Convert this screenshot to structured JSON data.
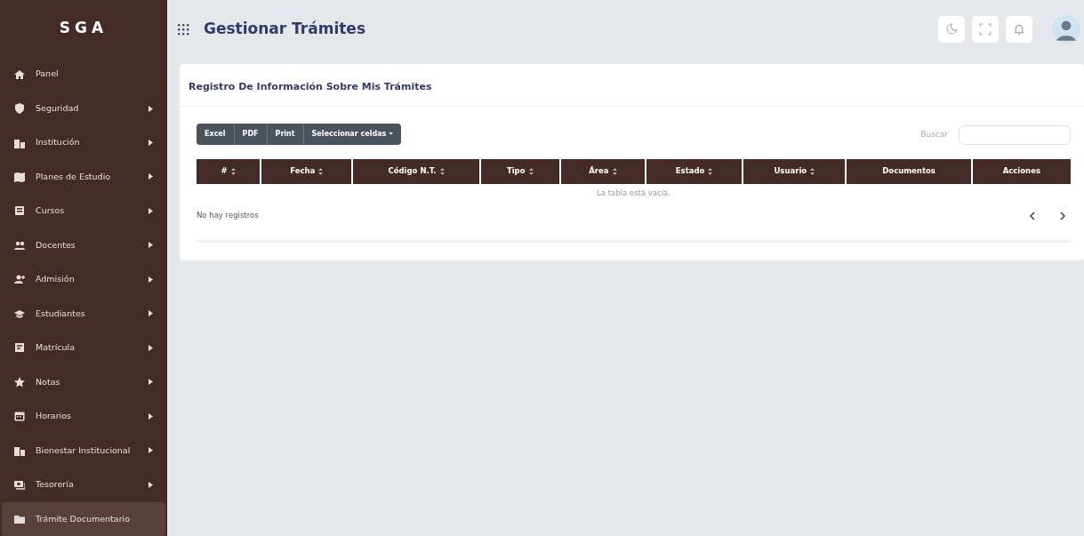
{
  "sidebar": {
    "brand": "SGA",
    "items": [
      {
        "label": "Panel",
        "expandable": false,
        "selected": false
      },
      {
        "label": "Seguridad",
        "expandable": true,
        "selected": false
      },
      {
        "label": "Institución",
        "expandable": true,
        "selected": false
      },
      {
        "label": "Planes de Estudio",
        "expandable": true,
        "selected": false
      },
      {
        "label": "Cursos",
        "expandable": true,
        "selected": false
      },
      {
        "label": "Docentes",
        "expandable": true,
        "selected": false
      },
      {
        "label": "Admisión",
        "expandable": true,
        "selected": false
      },
      {
        "label": "Estudiantes",
        "expandable": true,
        "selected": false
      },
      {
        "label": "Matrícula",
        "expandable": true,
        "selected": false
      },
      {
        "label": "Notas",
        "expandable": true,
        "selected": false
      },
      {
        "label": "Horarios",
        "expandable": true,
        "selected": false
      },
      {
        "label": "Bienestar Institucional",
        "expandable": true,
        "selected": false
      },
      {
        "label": "Tesorería",
        "expandable": true,
        "selected": false
      },
      {
        "label": "Trámite Documentario",
        "expandable": false,
        "selected": true
      }
    ]
  },
  "header": {
    "title": "Gestionar Trámites"
  },
  "card": {
    "title": "Registro De Información Sobre Mis Trámites",
    "export_buttons": [
      {
        "label": "Excel",
        "dropdown": false
      },
      {
        "label": "PDF",
        "dropdown": false
      },
      {
        "label": "Print",
        "dropdown": false
      },
      {
        "label": "Seleccionar celdas",
        "dropdown": true
      }
    ],
    "search_label": "Buscar",
    "table": {
      "columns": [
        {
          "label": "#",
          "sortable": true
        },
        {
          "label": "Fecha",
          "sortable": true
        },
        {
          "label": "Código N.T.",
          "sortable": true
        },
        {
          "label": "Tipo",
          "sortable": true
        },
        {
          "label": "Área",
          "sortable": true
        },
        {
          "label": "Estado",
          "sortable": true
        },
        {
          "label": "Usuario",
          "sortable": true
        },
        {
          "label": "Documentos",
          "sortable": false
        },
        {
          "label": "Acciones",
          "sortable": false
        }
      ],
      "empty_message": "La tabla está vacía."
    },
    "info": "No hay registros"
  }
}
